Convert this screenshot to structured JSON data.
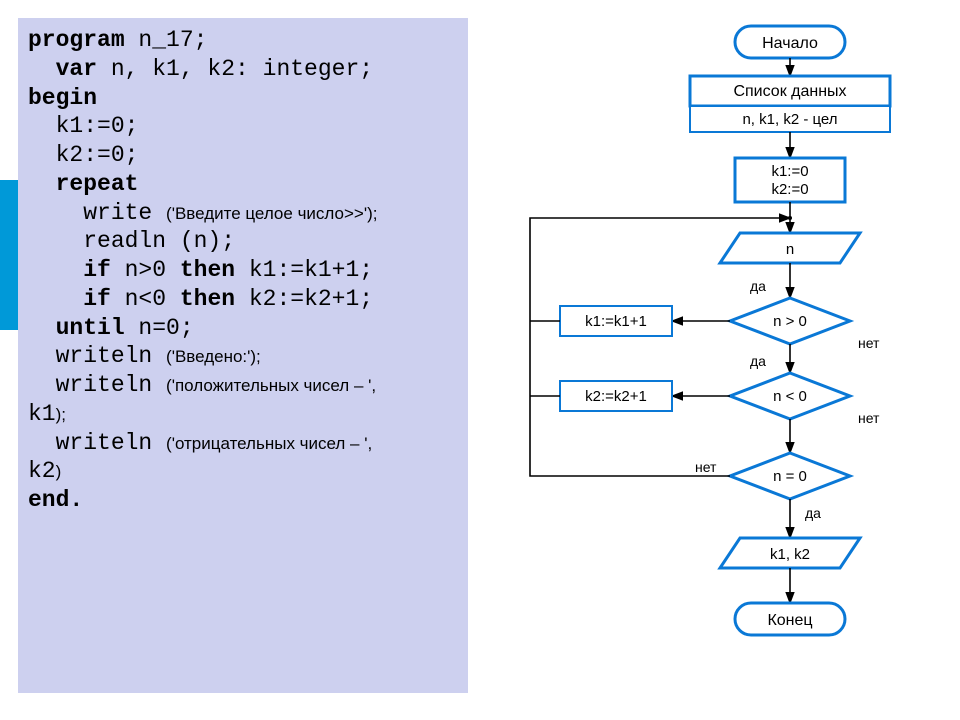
{
  "code": {
    "l1a": "program",
    "l1b": " n_17;",
    "l2a": "  var",
    "l2b": " n, k1, k2: integer;",
    "l3": "begin",
    "l4": "  k1:=0;",
    "l5": "  k2:=0;",
    "l6": "  repeat",
    "l7a": "    write ",
    "l7b": "('Введите целое число>>');",
    "l8": "    readln (n);",
    "l9a": "    if",
    "l9b": " n>0 ",
    "l9c": "then",
    "l9d": " k1:=k1+1;",
    "l10a": "    if",
    "l10b": " n<0 ",
    "l10c": "then",
    "l10d": " k2:=k2+1;",
    "l11a": "  until",
    "l11b": " n=0;",
    "l12a": "  writeln ",
    "l12b": "('Введено:');",
    "l13a": "  writeln ",
    "l13b": "('положительных чисел – ',",
    "l13c": "k1",
    "l13d": ");",
    "l14a": "  writeln ",
    "l14b": "('отрицательных чисел – ',",
    "l14c": "k2",
    "l14d": ")",
    "l15": "end."
  },
  "flow": {
    "start": "Начало",
    "data_title": "Список данных",
    "data_vars": "n, k1, k2 - цел",
    "init1": "k1:=0",
    "init2": "k2:=0",
    "input_n": "n",
    "cond1": "n > 0",
    "act1": "k1:=k1+1",
    "cond2": "n < 0",
    "act2": "k2:=k2+1",
    "cond3": "n = 0",
    "output": "k1, k2",
    "end": "Конец",
    "yes": "да",
    "no": "нет"
  }
}
